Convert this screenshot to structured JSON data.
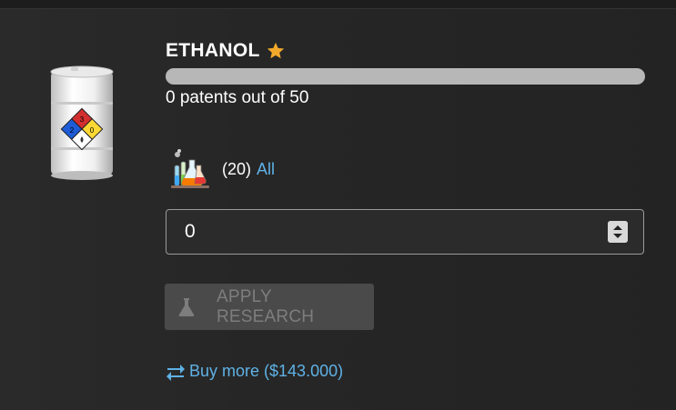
{
  "product": {
    "name": "ETHANOL",
    "favorite": true,
    "icon": "ethanol-barrel-icon",
    "patents_text": "0 patents out of 50",
    "patent_progress": 0.0
  },
  "research": {
    "icon": "lab-flasks-icon",
    "count_text": "(20)",
    "all_label": "All"
  },
  "quantity": {
    "value": "0"
  },
  "apply_button": {
    "label": "APPLY RESEARCH",
    "enabled": false,
    "icon": "flask-icon"
  },
  "buy_more": {
    "label": "Buy more ($143.000)",
    "icon": "swap-arrows-icon"
  },
  "colors": {
    "background": "#262626",
    "accent": "#5fb2e6",
    "star": "#f2a92b",
    "progress_track": "#b7b7b7",
    "button_disabled": "#4a4a4a"
  }
}
